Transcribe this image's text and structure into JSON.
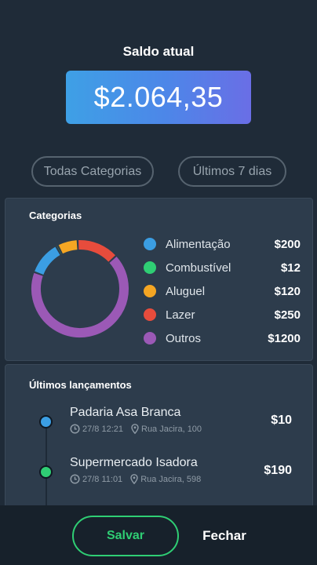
{
  "balance": {
    "label": "Saldo atual",
    "value": "$2.064,35"
  },
  "filters": {
    "category": "Todas Categorias",
    "period": "Últimos 7 dias"
  },
  "categories_card": {
    "title": "Categorias",
    "items": [
      {
        "label": "Alimentação",
        "value": "$200",
        "color": "#3b9ee3"
      },
      {
        "label": "Combustível",
        "value": "$12",
        "color": "#2fce74"
      },
      {
        "label": "Aluguel",
        "value": "$120",
        "color": "#f5a623"
      },
      {
        "label": "Lazer",
        "value": "$250",
        "color": "#e74c3c"
      },
      {
        "label": "Outros",
        "value": "$1200",
        "color": "#9b59b6"
      }
    ]
  },
  "chart_data": {
    "type": "pie",
    "categories": [
      "Alimentação",
      "Combustível",
      "Aluguel",
      "Lazer",
      "Outros"
    ],
    "values": [
      200,
      12,
      120,
      250,
      1200
    ],
    "colors": [
      "#3b9ee3",
      "#2fce74",
      "#f5a623",
      "#e74c3c",
      "#9b59b6"
    ]
  },
  "transactions_card": {
    "title": "Últimos lançamentos",
    "items": [
      {
        "name": "Padaria Asa Branca",
        "datetime": "27/8 12:21",
        "address": "Rua Jacira, 100",
        "amount": "$10",
        "dot_color": "#3b9ee3",
        "clock_icon": "clock-icon",
        "pin_icon": "location-pin-icon"
      },
      {
        "name": "Supermercado Isadora",
        "datetime": "27/8 11:01",
        "address": "Rua Jacira, 598",
        "amount": "$190",
        "dot_color": "#2fce74",
        "clock_icon": "clock-icon",
        "pin_icon": "location-pin-icon"
      }
    ]
  },
  "actions": {
    "save": "Salvar",
    "close": "Fechar"
  }
}
